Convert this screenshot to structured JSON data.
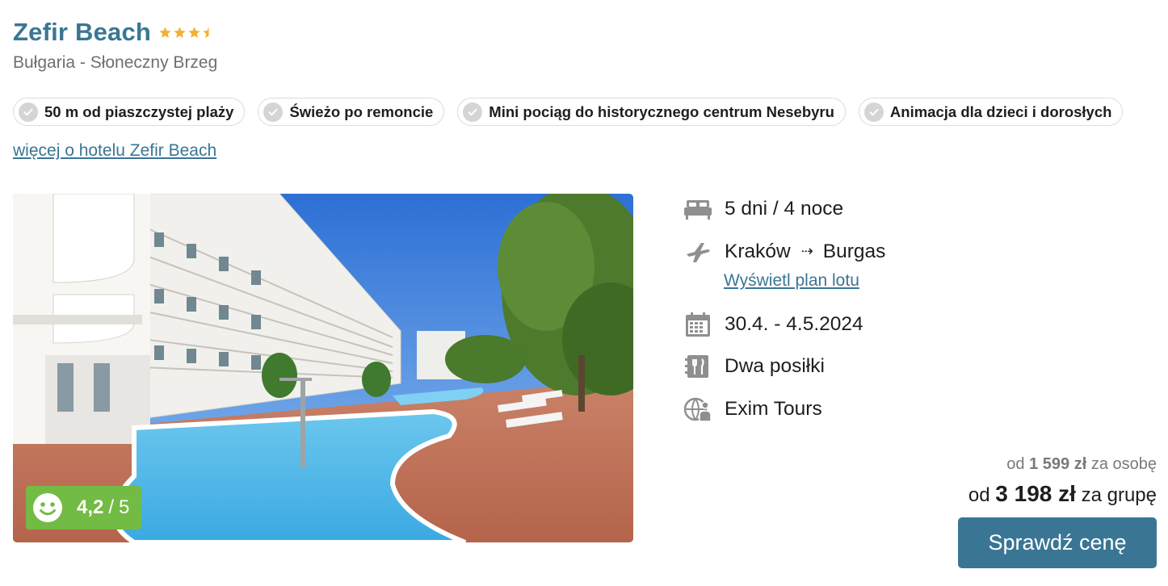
{
  "hotel": {
    "name": "Zefir Beach",
    "stars": 3.5,
    "location": "Bułgaria - Słoneczny Brzeg"
  },
  "features": [
    {
      "label": "50 m od piaszczystej plaży",
      "icon": "check-icon"
    },
    {
      "label": "Świeżo po remoncie",
      "icon": "check-icon"
    },
    {
      "label": "Mini pociąg do historycznego centrum Nesebyru",
      "icon": "check-icon"
    },
    {
      "label": "Animacja dla dzieci i dorosłych",
      "icon": "check-icon"
    }
  ],
  "more_link": "więcej o hotelu Zefir Beach",
  "rating": {
    "score": "4,2",
    "separator": "/",
    "max": "5",
    "color": "#72bb44",
    "icon": "smiley-face-icon"
  },
  "details": {
    "duration": {
      "text": "5 dni / 4 noce",
      "icon": "bed-icon"
    },
    "flight": {
      "from": "Kraków",
      "arrow": "⇢",
      "to": "Burgas",
      "icon": "plane-icon",
      "plan_link": "Wyświetl plan lotu"
    },
    "dates": {
      "text": "30.4. - 4.5.2024",
      "icon": "calendar-icon"
    },
    "meals": {
      "text": "Dwa posiłki",
      "icon": "meal-icon"
    },
    "operator": {
      "text": "Exim Tours",
      "icon": "globe-person-icon"
    }
  },
  "price": {
    "per_person_prefix": "od",
    "per_person_amount": "1 599 zł",
    "per_person_suffix": "za osobę",
    "group_prefix": "od",
    "group_amount": "3 198 zł",
    "group_suffix": "za grupę"
  },
  "cta_label": "Sprawdź cenę",
  "colors": {
    "brand": "#3a7694",
    "star": "#f2b230",
    "rating_bg": "#72bb44"
  }
}
